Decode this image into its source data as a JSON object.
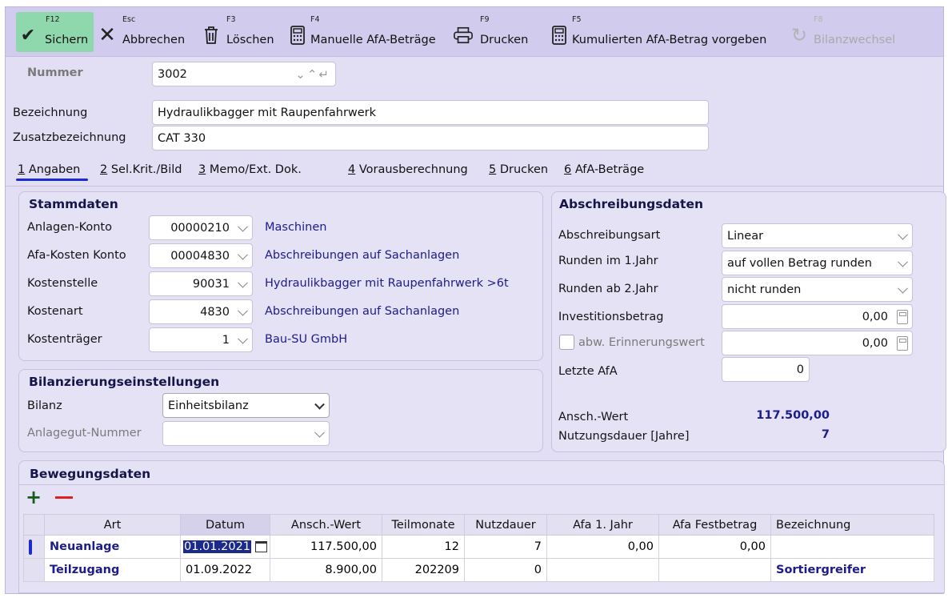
{
  "toolbar": {
    "save": {
      "key": "F12",
      "label": "Sichern"
    },
    "cancel": {
      "key": "Esc",
      "label": "Abbrechen"
    },
    "delete": {
      "key": "F3",
      "label": "Löschen"
    },
    "manual": {
      "key": "F4",
      "label": "Manuelle AfA-Beträge"
    },
    "print": {
      "key": "F9",
      "label": "Drucken"
    },
    "cumulative": {
      "key": "F5",
      "label": "Kumulierten AfA-Betrag vorgeben"
    },
    "balance": {
      "key": "F8",
      "label": "Bilanzwechsel"
    }
  },
  "header": {
    "nummer_label": "Nummer",
    "nummer_value": "3002",
    "bezeichnung_label": "Bezeichnung",
    "bezeichnung_value": "Hydraulikbagger mit Raupenfahrwerk",
    "zusatz_label": "Zusatzbezeichnung",
    "zusatz_value": "CAT 330"
  },
  "tabs": [
    {
      "num": "1",
      "label": " Angaben"
    },
    {
      "num": "2",
      "label": " Sel.Krit./Bild"
    },
    {
      "num": "3",
      "label": " Memo/Ext. Dok."
    },
    {
      "num": "4",
      "label": " Vorausberechnung"
    },
    {
      "num": "5",
      "label": " Drucken"
    },
    {
      "num": "6",
      "label": " AfA-Beträge"
    }
  ],
  "stammdaten": {
    "title": "Stammdaten",
    "rows": [
      {
        "label": "Anlagen-Konto",
        "value": "00000210",
        "desc": "Maschinen"
      },
      {
        "label": "Afa-Kosten Konto",
        "value": "00004830",
        "desc": "Abschreibungen auf Sachanlagen"
      },
      {
        "label": "Kostenstelle",
        "value": "90031",
        "desc": "Hydraulikbagger mit Raupenfahrwerk >6t"
      },
      {
        "label": "Kostenart",
        "value": "4830",
        "desc": "Abschreibungen auf Sachanlagen"
      },
      {
        "label": "Kostenträger",
        "value": "1",
        "desc": "Bau-SU GmbH"
      }
    ]
  },
  "bilanz": {
    "title": "Bilanzierungseinstellungen",
    "bilanz_label": "Bilanz",
    "bilanz_value": "Einheitsbilanz",
    "anlagegut_label": "Anlagegut-Nummer",
    "anlagegut_value": ""
  },
  "abschreibung": {
    "title": "Abschreibungsdaten",
    "art_label": "Abschreibungsart",
    "art_value": "Linear",
    "runden1_label": "Runden im 1.Jahr",
    "runden1_value": "auf vollen Betrag runden",
    "runden2_label": "Runden ab 2.Jahr",
    "runden2_value": "nicht runden",
    "invest_label": "Investitionsbetrag",
    "invest_value": "0,00",
    "erinnerung_label": "abw. Erinnerungswert",
    "erinnerung_value": "0,00",
    "letzte_label": "Letzte AfA",
    "letzte_value": "0",
    "ansch_label": "Ansch.-Wert",
    "ansch_value": "117.500,00",
    "nutzung_label": "Nutzungsdauer [Jahre]",
    "nutzung_value": "7"
  },
  "bewegung": {
    "title": "Bewegungsdaten",
    "columns": [
      "Art",
      "Datum",
      "Ansch.-Wert",
      "Teilmonate",
      "Nutzdauer",
      "Afa 1. Jahr",
      "Afa Festbetrag",
      "Bezeichnung"
    ],
    "rows": [
      {
        "art": "Neuanlage",
        "datum": "01.01.2021",
        "ansch": "117.500,00",
        "teil": "12",
        "nutz": "7",
        "afa1": "0,00",
        "fest": "0,00",
        "bez": ""
      },
      {
        "art": "Teilzugang",
        "datum": "01.09.2022",
        "ansch": "8.900,00",
        "teil": "202209",
        "nutz": "0",
        "afa1": "",
        "fest": "",
        "bez": "Sortiergreifer"
      }
    ]
  }
}
